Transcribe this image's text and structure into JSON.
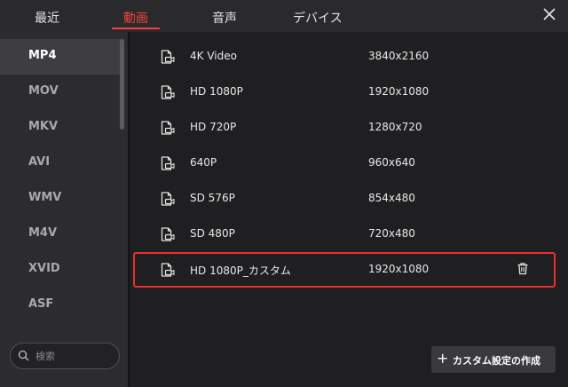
{
  "tabs": [
    {
      "label": "最近"
    },
    {
      "label": "動画"
    },
    {
      "label": "音声"
    },
    {
      "label": "デバイス"
    }
  ],
  "active_tab": "動画",
  "formats": [
    {
      "label": "MP4"
    },
    {
      "label": "MOV"
    },
    {
      "label": "MKV"
    },
    {
      "label": "AVI"
    },
    {
      "label": "WMV"
    },
    {
      "label": "M4V"
    },
    {
      "label": "XVID"
    },
    {
      "label": "ASF"
    }
  ],
  "selected_format": "MP4",
  "search": {
    "placeholder": "検索"
  },
  "presets": [
    {
      "name": "4K Video",
      "resolution": "3840x2160"
    },
    {
      "name": "HD 1080P",
      "resolution": "1920x1080"
    },
    {
      "name": "HD 720P",
      "resolution": "1280x720"
    },
    {
      "name": "640P",
      "resolution": "960x640"
    },
    {
      "name": "SD 576P",
      "resolution": "854x480"
    },
    {
      "name": "SD 480P",
      "resolution": "720x480"
    },
    {
      "name": "HD 1080P_カスタム",
      "resolution": "1920x1080"
    }
  ],
  "highlighted_preset": "HD 1080P_カスタム",
  "create_custom": {
    "label": "カスタム設定の作成"
  },
  "colors": {
    "accent": "#f0443a",
    "highlight_border": "#e8322c",
    "background": "#1f1f21",
    "sidebar": "#2c2c2f"
  },
  "icons": {
    "preset": "video-file-icon",
    "delete": "trash-icon",
    "close": "close-icon",
    "search": "search-icon",
    "add": "plus-icon"
  }
}
